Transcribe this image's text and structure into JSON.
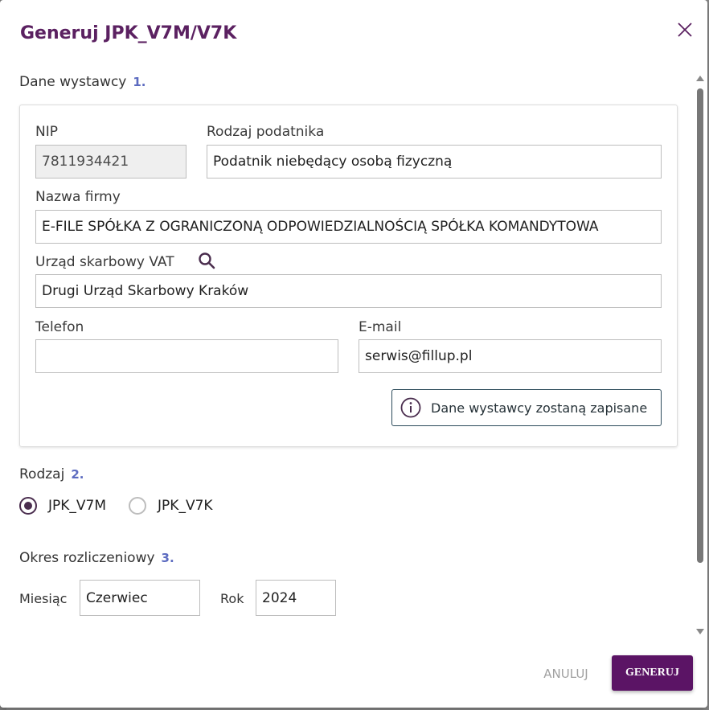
{
  "dialog": {
    "title": "Generuj JPK_V7M/V7K"
  },
  "issuer": {
    "section_label": "Dane wystawcy",
    "step": "1.",
    "nip_label": "NIP",
    "nip_value": "7811934421",
    "taxpayer_type_label": "Rodzaj podatnika",
    "taxpayer_type_value": "Podatnik niebędący osobą fizyczną",
    "company_label": "Nazwa firmy",
    "company_value": "E-FILE SPÓŁKA Z OGRANICZONĄ ODPOWIEDZIALNOŚCIĄ SPÓŁKA KOMANDYTOWA",
    "tax_office_label": "Urząd skarbowy VAT",
    "tax_office_value": "Drugi Urząd Skarbowy Kraków",
    "phone_label": "Telefon",
    "phone_value": "",
    "email_label": "E-mail",
    "email_value": "serwis@fillup.pl",
    "info_text": "Dane wystawcy zostaną zapisane"
  },
  "type": {
    "section_label": "Rodzaj",
    "step": "2.",
    "options": [
      "JPK_V7M",
      "JPK_V7K"
    ],
    "selected": "JPK_V7M"
  },
  "period": {
    "section_label": "Okres rozliczeniowy",
    "step": "3.",
    "month_label": "Miesiąc",
    "month_value": "Czerwiec",
    "year_label": "Rok",
    "year_value": "2024"
  },
  "footer": {
    "cancel_label": "ANULUJ",
    "generate_label": "GENERUJ"
  },
  "colors": {
    "brand": "#5b1465",
    "title": "#5b2161",
    "step": "#5c6bc0"
  },
  "icons": [
    "close-icon",
    "search-icon",
    "info-icon"
  ]
}
